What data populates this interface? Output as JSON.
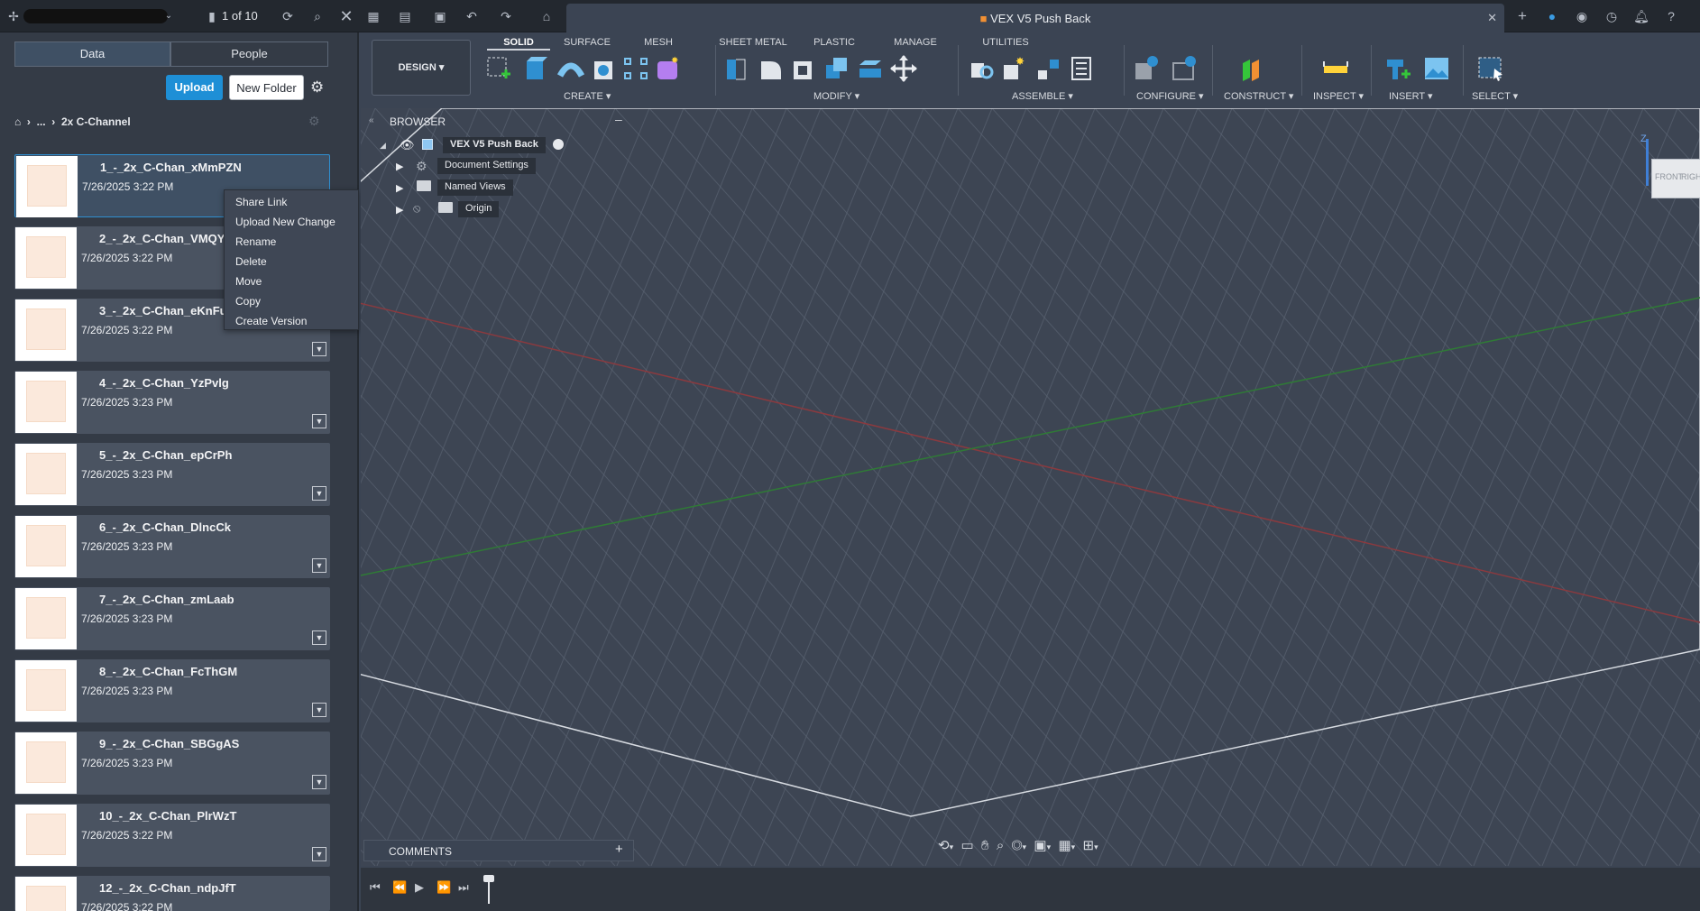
{
  "titlebar": {
    "page_counter": "1 of 10",
    "doc_title": "VEX V5 Push Back"
  },
  "data_panel": {
    "tabs": [
      "Data",
      "People"
    ],
    "upload_label": "Upload",
    "new_folder_label": "New Folder",
    "breadcrumb": {
      "ellipsis": "...",
      "current": "2x C-Channel"
    },
    "items": [
      {
        "name": "1_-_2x_C-Chan_xMmPZN",
        "date": "7/26/2025 3:22 PM"
      },
      {
        "name": "2_-_2x_C-Chan_VMQY",
        "date": "7/26/2025 3:22 PM"
      },
      {
        "name": "3_-_2x_C-Chan_eKnFu",
        "date": "7/26/2025 3:22 PM"
      },
      {
        "name": "4_-_2x_C-Chan_YzPvlg",
        "date": "7/26/2025 3:23 PM"
      },
      {
        "name": "5_-_2x_C-Chan_epCrPh",
        "date": "7/26/2025 3:23 PM"
      },
      {
        "name": "6_-_2x_C-Chan_DlncCk",
        "date": "7/26/2025 3:23 PM"
      },
      {
        "name": "7_-_2x_C-Chan_zmLaab",
        "date": "7/26/2025 3:23 PM"
      },
      {
        "name": "8_-_2x_C-Chan_FcThGM",
        "date": "7/26/2025 3:23 PM"
      },
      {
        "name": "9_-_2x_C-Chan_SBGgAS",
        "date": "7/26/2025 3:23 PM"
      },
      {
        "name": "10_-_2x_C-Chan_PlrWzT",
        "date": "7/26/2025 3:22 PM"
      },
      {
        "name": "12_-_2x_C-Chan_ndpJfT",
        "date": "7/26/2025 3:22 PM"
      }
    ]
  },
  "context_menu": [
    "Share Link",
    "Upload New Change",
    "Rename",
    "Delete",
    "Move",
    "Copy",
    "Create Version"
  ],
  "toolbar": {
    "workspace": "DESIGN",
    "tabs": [
      "SOLID",
      "SURFACE",
      "MESH",
      "SHEET METAL",
      "PLASTIC",
      "MANAGE",
      "UTILITIES"
    ],
    "active_tab": "SOLID",
    "groups": [
      "CREATE",
      "MODIFY",
      "ASSEMBLE",
      "CONFIGURE",
      "CONSTRUCT",
      "INSPECT",
      "INSERT",
      "SELECT"
    ]
  },
  "browser": {
    "title": "BROWSER",
    "root": "VEX V5 Push Back",
    "nodes": [
      "Document Settings",
      "Named Views",
      "Origin"
    ]
  },
  "viewcube": {
    "front": "FRONT",
    "right": "RIGHT",
    "z": "Z"
  },
  "comments_label": "COMMENTS",
  "colors": {
    "accent": "#1e8fd6",
    "panel_bg": "#343b46",
    "viewport_bg": "#3d4553"
  }
}
